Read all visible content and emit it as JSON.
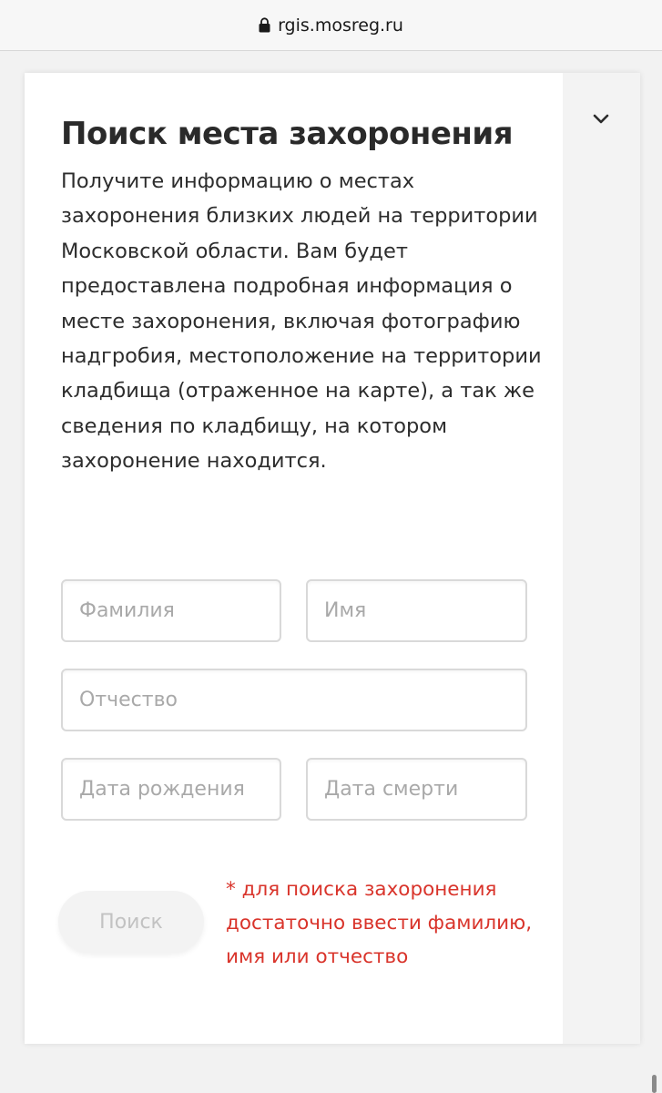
{
  "browser": {
    "url": "rgis.mosreg.ru"
  },
  "page": {
    "title": "Поиск места захоронения",
    "description": "Получите информацию о местах захоронения близких людей на территории Московской области. Вам будет предоставлена подробная информация о месте захоронения, включая фотографию надгробия, местоположение на территории кладбища (отраженное на карте), а так же сведения по кладбищу, на котором захоронение находится."
  },
  "form": {
    "last_name_placeholder": "Фамилия",
    "first_name_placeholder": "Имя",
    "middle_name_placeholder": "Отчество",
    "birth_date_placeholder": "Дата рождения",
    "death_date_placeholder": "Дата смерти",
    "search_label": "Поиск",
    "note": "* для поиска захоронения достаточно ввести фамилию, имя или отчество"
  },
  "icons": {
    "lock": "lock-icon",
    "collapse": "chevron-down-icon"
  },
  "colors": {
    "note_red": "#d9342b",
    "button_bg": "#f3f3f3",
    "button_text": "#c2c2c2"
  }
}
